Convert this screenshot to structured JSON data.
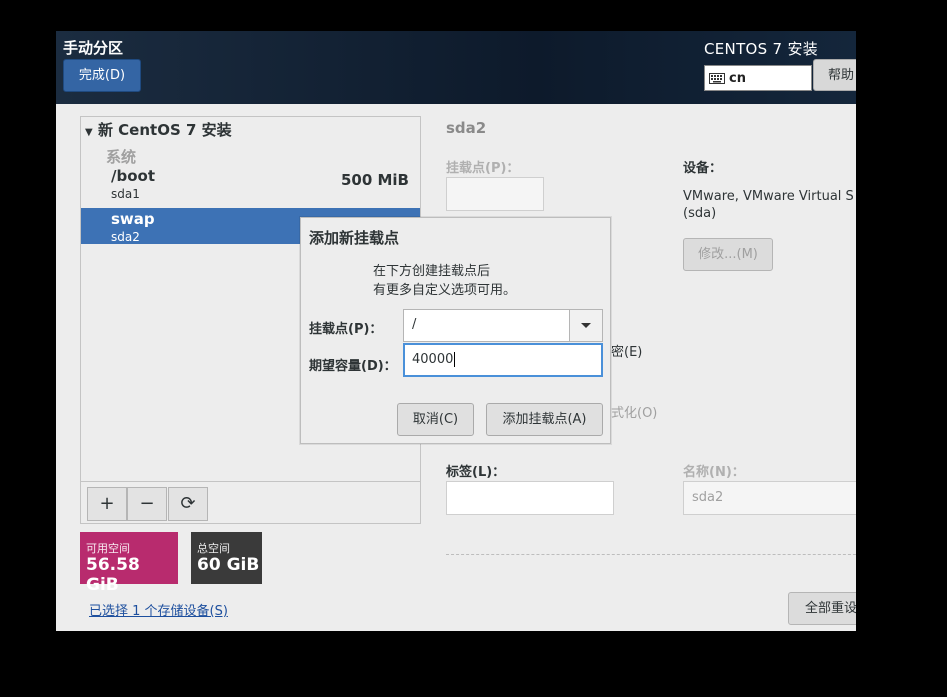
{
  "header": {
    "title": "手动分区",
    "done_button": "完成(D)",
    "product": "CENTOS 7 安装",
    "keyboard_layout": "cn",
    "help_button": "帮助"
  },
  "left": {
    "installation_title": "新 CentOS 7 安装",
    "system_label": "系统",
    "partitions": [
      {
        "name": "/boot",
        "device": "sda1",
        "size": "500 MiB"
      },
      {
        "name": "swap",
        "device": "sda2",
        "size": ""
      }
    ],
    "toolbar": {
      "add": "+",
      "remove": "−",
      "refresh": "⟳"
    }
  },
  "space": {
    "available_label": "可用空间",
    "available_value": "56.58 GiB",
    "total_label": "总空间",
    "total_value": "60 GiB"
  },
  "storage_link": "已选择 1 个存储设备(S)",
  "right": {
    "partition_title": "sda2",
    "mount_label": "挂载点(P)：",
    "device_label": "设备：",
    "device_value_line1": "VMware, VMware Virtual S",
    "device_value_line2": "(sda)",
    "modify_button": "修改...(M)",
    "encrypt_fragment": "密(E)",
    "format_fragment": "式化(O)",
    "tag_label": "标签(L)：",
    "name_label": "名称(N)：",
    "name_value": "sda2",
    "reset_button": "全部重设"
  },
  "dialog": {
    "title": "添加新挂载点",
    "desc_line1": "在下方创建挂载点后",
    "desc_line2": "有更多自定义选项可用。",
    "mount_label": "挂载点(P)：",
    "mount_value": "/",
    "capacity_label": "期望容量(D)：",
    "capacity_value": "40000",
    "cancel_button": "取消(C)",
    "add_button": "添加挂载点(A)"
  }
}
